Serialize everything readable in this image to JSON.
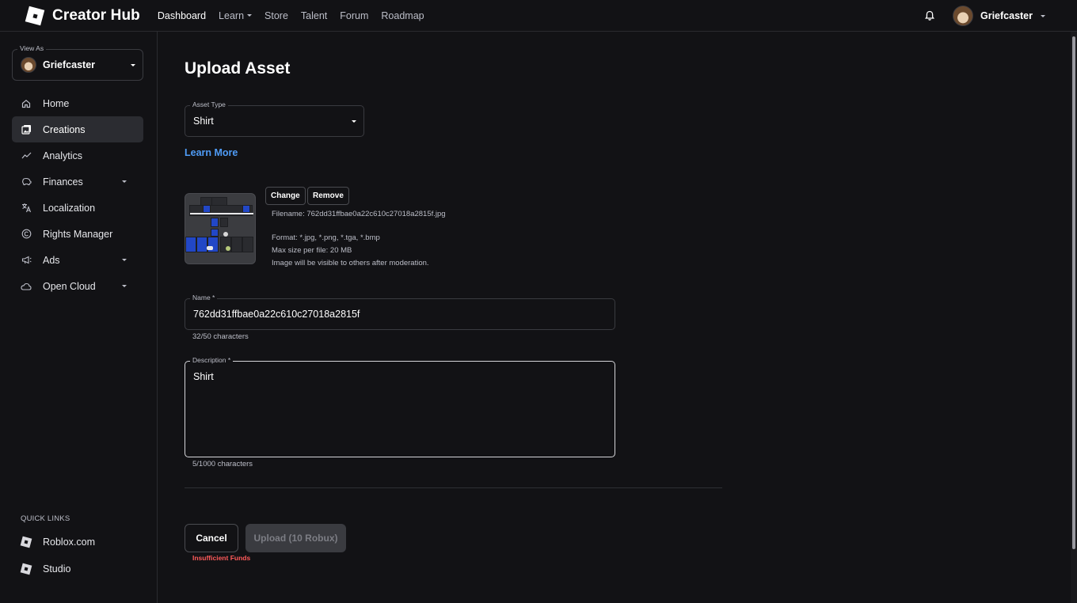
{
  "brand": {
    "title": "Creator Hub"
  },
  "topnav": [
    {
      "label": "Dashboard",
      "active": true,
      "dropdown": false
    },
    {
      "label": "Learn",
      "active": false,
      "dropdown": true
    },
    {
      "label": "Store",
      "active": false,
      "dropdown": false
    },
    {
      "label": "Talent",
      "active": false,
      "dropdown": false
    },
    {
      "label": "Forum",
      "active": false,
      "dropdown": false
    },
    {
      "label": "Roadmap",
      "active": false,
      "dropdown": false
    }
  ],
  "user": {
    "name": "Griefcaster"
  },
  "sidebar": {
    "view_as_label": "View As",
    "view_as_name": "Griefcaster",
    "items": [
      {
        "label": "Home",
        "icon": "home-icon",
        "active": false,
        "expandable": false
      },
      {
        "label": "Creations",
        "icon": "creations-icon",
        "active": true,
        "expandable": false
      },
      {
        "label": "Analytics",
        "icon": "analytics-icon",
        "active": false,
        "expandable": false
      },
      {
        "label": "Finances",
        "icon": "finances-icon",
        "active": false,
        "expandable": true
      },
      {
        "label": "Localization",
        "icon": "translate-icon",
        "active": false,
        "expandable": false
      },
      {
        "label": "Rights Manager",
        "icon": "copyright-icon",
        "active": false,
        "expandable": false
      },
      {
        "label": "Ads",
        "icon": "megaphone-icon",
        "active": false,
        "expandable": true
      },
      {
        "label": "Open Cloud",
        "icon": "cloud-icon",
        "active": false,
        "expandable": true
      }
    ],
    "quick_links_title": "QUICK LINKS",
    "quick_links": [
      {
        "label": "Roblox.com",
        "icon": "roblox-logo-icon"
      },
      {
        "label": "Studio",
        "icon": "studio-logo-icon"
      }
    ]
  },
  "main": {
    "title": "Upload Asset",
    "asset_type": {
      "label": "Asset Type",
      "value": "Shirt"
    },
    "learn_more": "Learn More",
    "file": {
      "change_label": "Change",
      "remove_label": "Remove",
      "filename": "Filename: 762dd31ffbae0a22c610c27018a2815f.jpg",
      "format": "Format: *.jpg, *.png, *.tga, *.bmp",
      "max_size": "Max size per file: 20 MB",
      "visibility": "Image will be visible to others after moderation."
    },
    "name_field": {
      "label": "Name *",
      "value": "762dd31ffbae0a22c610c27018a2815f",
      "helper": "32/50 characters"
    },
    "description_field": {
      "label": "Description *",
      "value": "Shirt",
      "helper": "5/1000 characters"
    },
    "cancel_label": "Cancel",
    "upload_label": "Upload (10 Robux)",
    "error": "Insufficient Funds"
  },
  "colors": {
    "background": "#121215",
    "accent_link": "#4f9cf7",
    "error": "#ff5a5a",
    "active_nav": "#2b2c31",
    "disabled_button": "#3a3b40"
  }
}
